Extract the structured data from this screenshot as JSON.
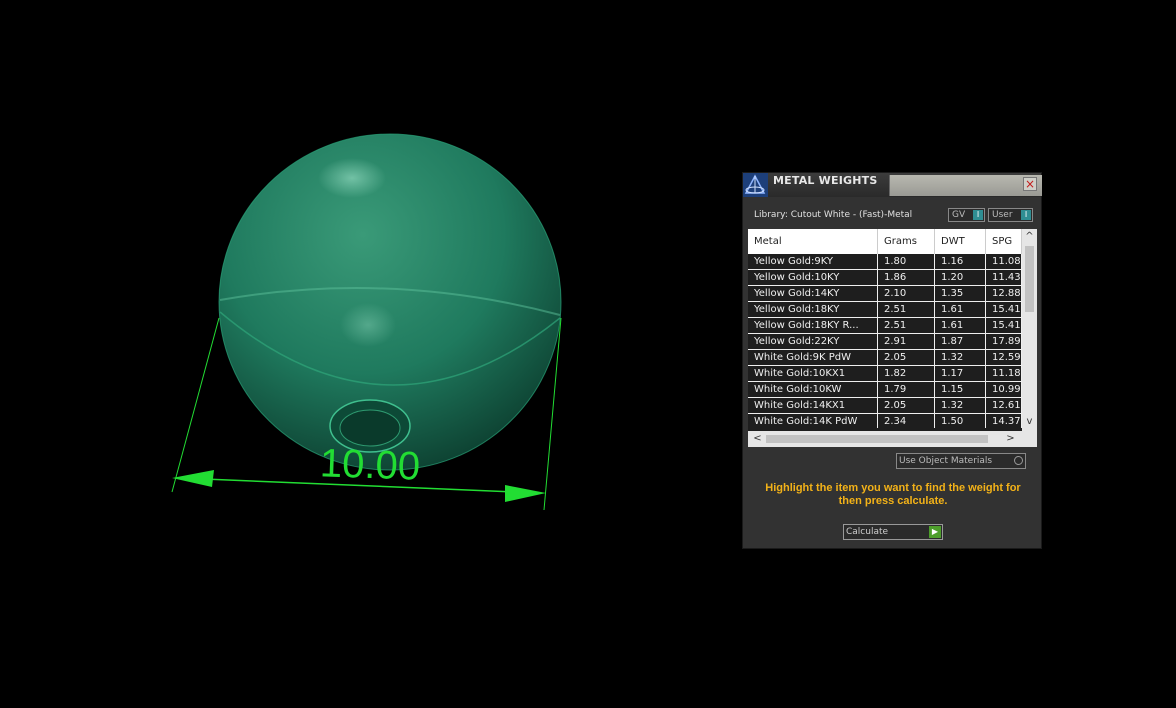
{
  "viewport": {
    "dimension_label": "10.00",
    "accent_color": "#22dd33",
    "object_color": "#1f7a5e"
  },
  "panel": {
    "title": "METAL WEIGHTS",
    "close_icon": "×",
    "library_label": "Library: Cutout White - (Fast)-Metal",
    "toggle_gv": "GV",
    "toggle_user": "User",
    "toggle_indicator": "I",
    "columns": [
      "Metal",
      "Grams",
      "DWT",
      "SPG"
    ],
    "rows": [
      {
        "metal": "Yellow Gold:9KY",
        "grams": "1.80",
        "dwt": "1.16",
        "spg": "11.08"
      },
      {
        "metal": "Yellow Gold:10KY",
        "grams": "1.86",
        "dwt": "1.20",
        "spg": "11.43"
      },
      {
        "metal": "Yellow Gold:14KY",
        "grams": "2.10",
        "dwt": "1.35",
        "spg": "12.88"
      },
      {
        "metal": "Yellow Gold:18KY",
        "grams": "2.51",
        "dwt": "1.61",
        "spg": "15.41"
      },
      {
        "metal": "Yellow Gold:18KY R...",
        "grams": "2.51",
        "dwt": "1.61",
        "spg": "15.41"
      },
      {
        "metal": "Yellow Gold:22KY",
        "grams": "2.91",
        "dwt": "1.87",
        "spg": "17.89"
      },
      {
        "metal": "White Gold:9K PdW",
        "grams": "2.05",
        "dwt": "1.32",
        "spg": "12.59"
      },
      {
        "metal": "White Gold:10KX1",
        "grams": "1.82",
        "dwt": "1.17",
        "spg": "11.18"
      },
      {
        "metal": "White Gold:10KW",
        "grams": "1.79",
        "dwt": "1.15",
        "spg": "10.99"
      },
      {
        "metal": "White Gold:14KX1",
        "grams": "2.05",
        "dwt": "1.32",
        "spg": "12.61"
      },
      {
        "metal": "White Gold:14K PdW",
        "grams": "2.34",
        "dwt": "1.50",
        "spg": "14.37"
      }
    ],
    "use_object_materials": "Use Object Materials",
    "hint": "Highlight the item you want to find the weight for then press calculate.",
    "calculate_label": "Calculate",
    "calculate_icon": "▶",
    "hint_color": "#f3b218"
  }
}
